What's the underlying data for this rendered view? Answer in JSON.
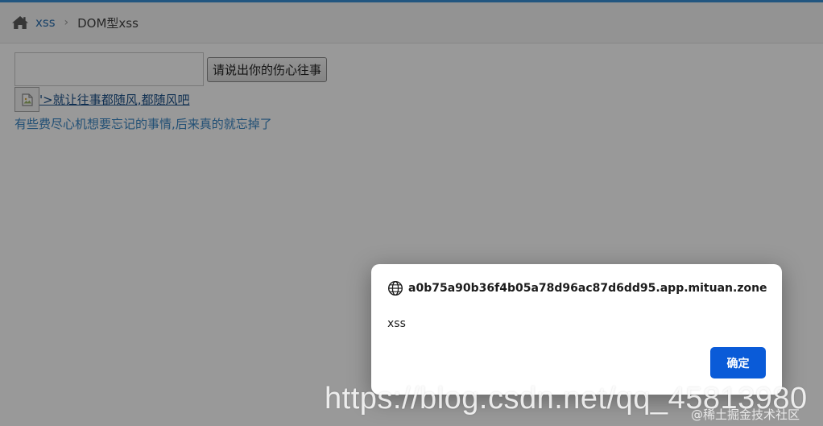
{
  "breadcrumb": {
    "home_icon": "home-icon",
    "link": "xss",
    "separator": "›",
    "current": "DOM型xss"
  },
  "form": {
    "input_value": "",
    "button_label": "请说出你的伤心往事"
  },
  "result": {
    "broken_image_icon": "broken-image-icon",
    "link_text": "'>就让往事都随风,都随风吧",
    "tip": "有些费尽心机想要忘记的事情,后来真的就忘掉了"
  },
  "alert": {
    "globe_icon": "globe-icon",
    "host": "a0b75a90b36f4b05a78d96ac87d6dd95.app.mituan.zone",
    "message": "xss",
    "ok_label": "确定"
  },
  "watermark": {
    "url": "https://blog.csdn.net/qq_45813980",
    "community": "@稀土掘金技术社区"
  },
  "colors": {
    "accent": "#3a8fd6",
    "link": "#2a6fb0",
    "ok_button": "#0a5bd8",
    "overlay": "rgba(0,0,0,0.40)"
  }
}
